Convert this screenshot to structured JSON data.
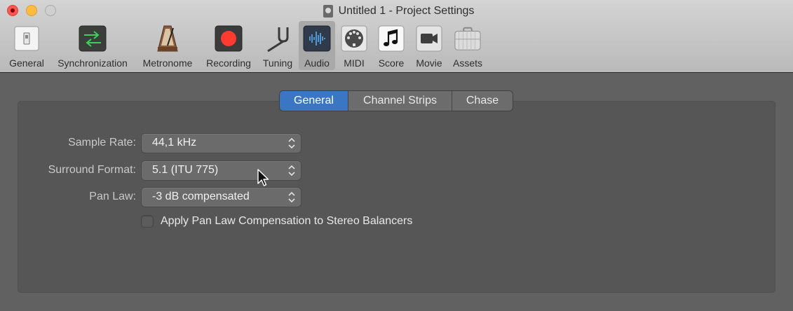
{
  "window": {
    "title": "Untitled 1 - Project Settings",
    "controls": [
      "close",
      "minimize",
      "zoom"
    ]
  },
  "toolbar": {
    "items": [
      {
        "label": "General",
        "icon": "switch-icon"
      },
      {
        "label": "Synchronization",
        "icon": "sync-arrows-icon"
      },
      {
        "label": "Metronome",
        "icon": "metronome-icon"
      },
      {
        "label": "Recording",
        "icon": "record-icon"
      },
      {
        "label": "Tuning",
        "icon": "tuning-fork-icon"
      },
      {
        "label": "Audio",
        "icon": "waveform-icon",
        "active": true
      },
      {
        "label": "MIDI",
        "icon": "midi-port-icon"
      },
      {
        "label": "Score",
        "icon": "music-note-icon"
      },
      {
        "label": "Movie",
        "icon": "video-camera-icon"
      },
      {
        "label": "Assets",
        "icon": "briefcase-icon"
      }
    ]
  },
  "tabs": [
    {
      "label": "General",
      "active": true
    },
    {
      "label": "Channel Strips",
      "active": false
    },
    {
      "label": "Chase",
      "active": false
    }
  ],
  "settings": {
    "sample_rate": {
      "label": "Sample Rate:",
      "value": "44,1 kHz"
    },
    "surround_format": {
      "label": "Surround Format:",
      "value": "5.1 (ITU 775)"
    },
    "pan_law": {
      "label": "Pan Law:",
      "value": "-3 dB compensated"
    },
    "stereo_balancer_comp": {
      "label": "Apply Pan Law Compensation to Stereo Balancers",
      "checked": false
    }
  },
  "colors": {
    "accent": "#3a76c4",
    "record": "#ff3b30",
    "close": "#fc5753",
    "minimize": "#fdbc40"
  }
}
